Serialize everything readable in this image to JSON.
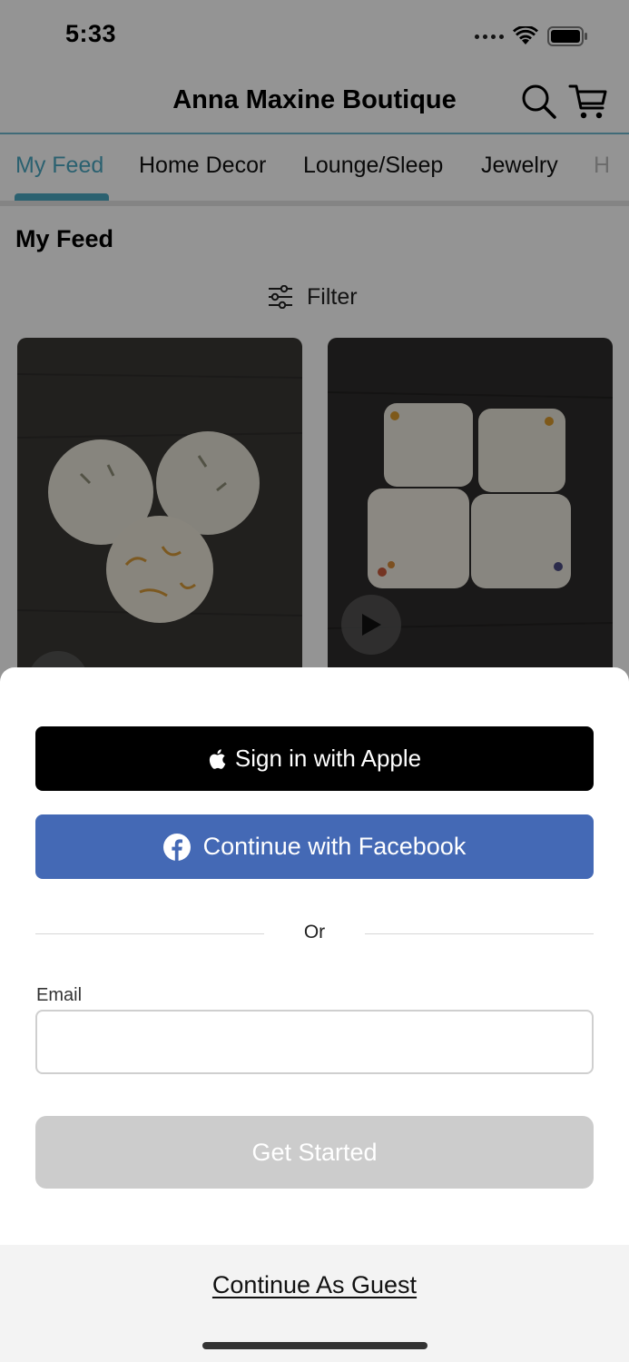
{
  "status_bar": {
    "time": "5:33"
  },
  "header": {
    "title": "Anna Maxine Boutique"
  },
  "tabs": [
    {
      "label": "My Feed",
      "active": true
    },
    {
      "label": "Home Decor",
      "active": false
    },
    {
      "label": "Lounge/Sleep",
      "active": false
    },
    {
      "label": "Jewelry",
      "active": false
    },
    {
      "label": "H",
      "active": false
    }
  ],
  "feed": {
    "title": "My Feed",
    "filter_label": "Filter"
  },
  "sheet": {
    "apple_label": "Sign in with Apple",
    "facebook_label": "Continue with Facebook",
    "or_label": "Or",
    "email_label": "Email",
    "email_value": "",
    "email_placeholder": "",
    "get_started_label": "Get Started",
    "guest_label": "Continue As Guest"
  },
  "colors": {
    "accent": "#4aa7c2",
    "facebook": "#4469b5",
    "apple": "#000000",
    "disabled_button": "#cccccc"
  },
  "icons": [
    "signal-icon",
    "wifi-icon",
    "battery-icon",
    "search-icon",
    "cart-icon",
    "filter-icon",
    "play-icon",
    "apple-icon",
    "facebook-icon"
  ]
}
